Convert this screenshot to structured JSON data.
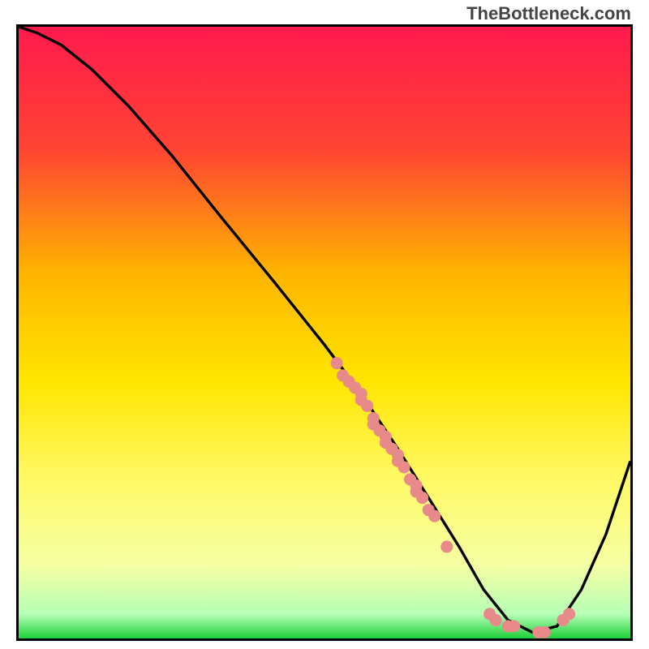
{
  "watermark": "TheBottleneck.com",
  "chart_data": {
    "type": "line",
    "title": "",
    "xlabel": "",
    "ylabel": "",
    "xlim": [
      0,
      100
    ],
    "ylim": [
      0,
      100
    ],
    "background_gradient_stops": [
      {
        "offset": 0,
        "color": "#ff1a4d"
      },
      {
        "offset": 20,
        "color": "#ff4433"
      },
      {
        "offset": 40,
        "color": "#ffb300"
      },
      {
        "offset": 58,
        "color": "#ffe600"
      },
      {
        "offset": 74,
        "color": "#fff966"
      },
      {
        "offset": 88,
        "color": "#f5ffa3"
      },
      {
        "offset": 96,
        "color": "#b6ffb6"
      },
      {
        "offset": 100,
        "color": "#1fd13a"
      }
    ],
    "series": [
      {
        "name": "curve",
        "type": "line",
        "color": "#000000",
        "x": [
          0,
          3,
          7,
          12,
          18,
          25,
          33,
          42,
          50,
          56,
          62,
          67,
          72,
          76,
          80,
          84,
          88,
          92,
          96,
          100
        ],
        "y": [
          100,
          99,
          97,
          93,
          87,
          79,
          69,
          58,
          48,
          40,
          31,
          23,
          15,
          8,
          3,
          1,
          2,
          8,
          17,
          29
        ]
      },
      {
        "name": "markers",
        "type": "scatter",
        "color": "#e98a8a",
        "points": [
          {
            "x": 52,
            "y": 45
          },
          {
            "x": 53,
            "y": 43
          },
          {
            "x": 54,
            "y": 42
          },
          {
            "x": 55,
            "y": 41
          },
          {
            "x": 56,
            "y": 40
          },
          {
            "x": 56,
            "y": 39
          },
          {
            "x": 57,
            "y": 38
          },
          {
            "x": 58,
            "y": 36
          },
          {
            "x": 58,
            "y": 35
          },
          {
            "x": 59,
            "y": 34
          },
          {
            "x": 60,
            "y": 33
          },
          {
            "x": 60,
            "y": 32
          },
          {
            "x": 61,
            "y": 31
          },
          {
            "x": 62,
            "y": 29
          },
          {
            "x": 62,
            "y": 30
          },
          {
            "x": 63,
            "y": 28
          },
          {
            "x": 64,
            "y": 26
          },
          {
            "x": 65,
            "y": 25
          },
          {
            "x": 65,
            "y": 24
          },
          {
            "x": 66,
            "y": 23
          },
          {
            "x": 67,
            "y": 21
          },
          {
            "x": 68,
            "y": 20
          },
          {
            "x": 70,
            "y": 15
          },
          {
            "x": 77,
            "y": 4
          },
          {
            "x": 78,
            "y": 3
          },
          {
            "x": 80,
            "y": 2
          },
          {
            "x": 81,
            "y": 2
          },
          {
            "x": 85,
            "y": 1
          },
          {
            "x": 86,
            "y": 1
          },
          {
            "x": 89,
            "y": 3
          },
          {
            "x": 90,
            "y": 4
          }
        ]
      }
    ]
  }
}
